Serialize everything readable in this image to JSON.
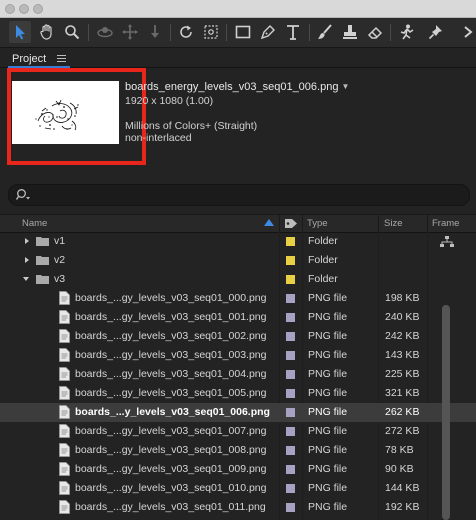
{
  "project": {
    "tab_label": "Project",
    "selected_item": {
      "filename": "boards_energy_levels_v03_seq01_006.png",
      "dimensions": "1920 x 1080 (1.00)",
      "color_depth": "Millions of Colors+ (Straight)",
      "interlace": "non-interlaced"
    }
  },
  "columns": {
    "name": "Name",
    "type": "Type",
    "size": "Size",
    "frame": "Frame"
  },
  "colors": {
    "folder_label": "#e8cf44",
    "png_label": "#a7a1c4",
    "highlight": "#e8261c",
    "sort_accent": "#3d8be0"
  },
  "rows": [
    {
      "kind": "folder",
      "name": "v1",
      "type": "Folder",
      "size": "",
      "expanded": false
    },
    {
      "kind": "folder",
      "name": "v2",
      "type": "Folder",
      "size": "",
      "expanded": false
    },
    {
      "kind": "folder",
      "name": "v3",
      "type": "Folder",
      "size": "",
      "expanded": true
    },
    {
      "kind": "file",
      "name": "boards_...gy_levels_v03_seq01_000.png",
      "type": "PNG file",
      "size": "198 KB"
    },
    {
      "kind": "file",
      "name": "boards_...gy_levels_v03_seq01_001.png",
      "type": "PNG file",
      "size": "240 KB"
    },
    {
      "kind": "file",
      "name": "boards_...gy_levels_v03_seq01_002.png",
      "type": "PNG file",
      "size": "242 KB"
    },
    {
      "kind": "file",
      "name": "boards_...gy_levels_v03_seq01_003.png",
      "type": "PNG file",
      "size": "143 KB"
    },
    {
      "kind": "file",
      "name": "boards_...gy_levels_v03_seq01_004.png",
      "type": "PNG file",
      "size": "225 KB"
    },
    {
      "kind": "file",
      "name": "boards_...gy_levels_v03_seq01_005.png",
      "type": "PNG file",
      "size": "321 KB"
    },
    {
      "kind": "file",
      "name": "boards_...y_levels_v03_seq01_006.png",
      "type": "PNG file",
      "size": "262 KB",
      "selected": true
    },
    {
      "kind": "file",
      "name": "boards_...gy_levels_v03_seq01_007.png",
      "type": "PNG file",
      "size": "272 KB"
    },
    {
      "kind": "file",
      "name": "boards_...gy_levels_v03_seq01_008.png",
      "type": "PNG file",
      "size": "78 KB"
    },
    {
      "kind": "file",
      "name": "boards_...gy_levels_v03_seq01_009.png",
      "type": "PNG file",
      "size": "90 KB"
    },
    {
      "kind": "file",
      "name": "boards_...gy_levels_v03_seq01_010.png",
      "type": "PNG file",
      "size": "144 KB"
    },
    {
      "kind": "file",
      "name": "boards_...gy_levels_v03_seq01_011.png",
      "type": "PNG file",
      "size": "192 KB"
    }
  ]
}
